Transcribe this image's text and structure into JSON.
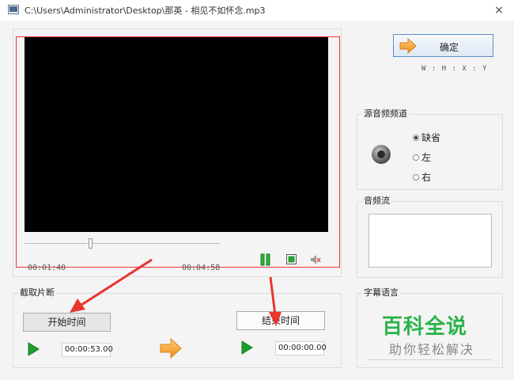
{
  "window": {
    "title": "C:\\Users\\Administrator\\Desktop\\那英 - 相见不如怀念.mp3",
    "close_label": "×"
  },
  "player": {
    "current_time": "00:01:40",
    "total_time": "00:04:58",
    "seek_progress": 0.34
  },
  "clip": {
    "group_label": "截取片断",
    "start_label": "开始时间",
    "end_label": "结束时间",
    "start_value": "00:00:53.00",
    "end_value": "00:00:00.00"
  },
  "ok": {
    "label": "确定",
    "whxy": "W : H : X : Y"
  },
  "channel": {
    "group_label": "源音频频道",
    "options": [
      "缺省",
      "左",
      "右"
    ],
    "selected": "缺省"
  },
  "audio_stream": {
    "group_label": "音频流"
  },
  "subtitle": {
    "group_label": "字幕语言",
    "watermark_title": "百科全说",
    "watermark_subtitle": "助你轻松解决"
  },
  "colors": {
    "accent_red": "#ee3333",
    "play_green": "#1e9e2e",
    "arrow_orange": "#f39a1e",
    "watermark_green": "#2ab34a"
  }
}
